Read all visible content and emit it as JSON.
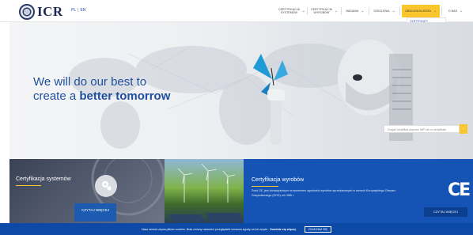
{
  "header": {
    "logo_text": "ICR",
    "lang_pl": "PL",
    "lang_sep": "|",
    "lang_en": "EN",
    "nav": [
      {
        "label": "CERTYFIKACJA SYSTEMÓW",
        "active": false
      },
      {
        "label": "CERTYFIKACJA WYROBÓW",
        "active": false
      },
      {
        "label": "BADANIA",
        "active": false
      },
      {
        "label": "SZKOLENIA",
        "active": false
      },
      {
        "label": "OBSŁUGA KLIENTA",
        "active": true
      },
      {
        "label": "O NAS",
        "active": false
      }
    ],
    "dropdown": [
      "CERTYFIKATY ZAWIESZONE I COFNIĘTE",
      "FORMULARZ KONTAKTOWY",
      "DOKUMENTY DO POBRANIA"
    ]
  },
  "hero": {
    "line1": "We will do our best to",
    "line2_pre": "create a ",
    "line2_bold": "better tomorrow",
    "search_placeholder": "Znajdź certyfikat poprzez NIP lub nr certyfikatu",
    "search_button": "›"
  },
  "cards": {
    "systems_title": "Certyfikacja systemów",
    "systems_button": "CZYTAJ WIĘCEJ",
    "products_title": "Certyfikacja wyrobów",
    "products_text": "Znak CE, jest obowiązkowym oznaczeniem zgodności wyrobów sprzedawanych w ramach Europejskiego Obszaru Gospodarczego (EOG) od 1985 r.",
    "products_logo": "CE",
    "products_button": "CZYTAJ WIĘCEJ"
  },
  "cookie": {
    "text": "Nasz serwis używa plików cookies. Brak zmiany ustawień przeglądarki oznacza zgodę na ich użycie.",
    "link": "Dowiedz się więcej.",
    "accept": "ZGADZAM SIĘ"
  }
}
